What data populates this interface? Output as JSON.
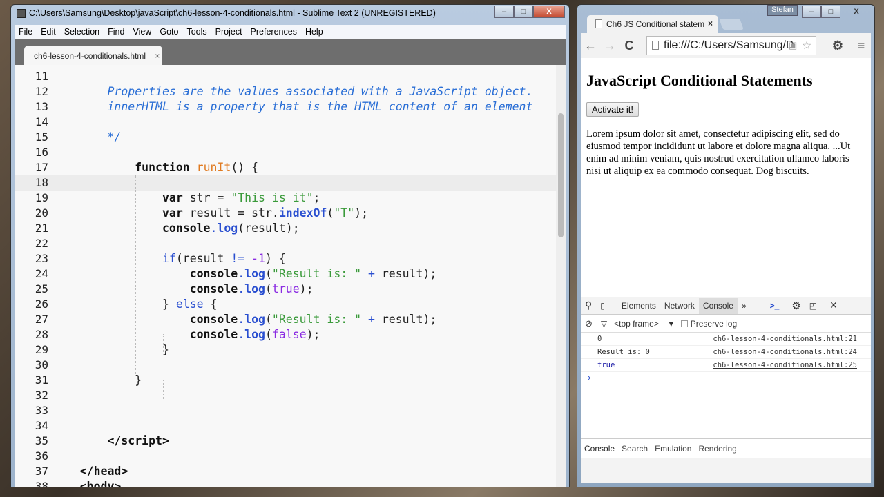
{
  "editor": {
    "title": "C:\\Users\\Samsung\\Desktop\\javaScript\\ch6-lesson-4-conditionals.html - Sublime Text 2 (UNREGISTERED)",
    "menu": [
      "File",
      "Edit",
      "Selection",
      "Find",
      "View",
      "Goto",
      "Tools",
      "Project",
      "Preferences",
      "Help"
    ],
    "tab": "ch6-lesson-4-conditionals.html",
    "tab_close": "×",
    "window_buttons": [
      "–",
      "□",
      "X"
    ],
    "lines": [
      {
        "n": "11",
        "t": []
      },
      {
        "n": "12",
        "t": [
          [
            "        ",
            "p"
          ],
          [
            "Properties are the values associated with a JavaScript object.",
            "c"
          ]
        ]
      },
      {
        "n": "13",
        "t": [
          [
            "        ",
            "p"
          ],
          [
            "innerHTML is a property that is the HTML content of an element",
            "c"
          ]
        ]
      },
      {
        "n": "14",
        "t": []
      },
      {
        "n": "15",
        "t": [
          [
            "        ",
            "p"
          ],
          [
            "*/",
            "c"
          ]
        ]
      },
      {
        "n": "16",
        "t": []
      },
      {
        "n": "17",
        "t": [
          [
            "            ",
            "p"
          ],
          [
            "function",
            "k"
          ],
          [
            " ",
            "p"
          ],
          [
            "runIt",
            "f"
          ],
          [
            "() {",
            "p"
          ]
        ]
      },
      {
        "n": "18",
        "t": [],
        "cur": true
      },
      {
        "n": "19",
        "t": [
          [
            "                ",
            "p"
          ],
          [
            "var",
            "k"
          ],
          [
            " str = ",
            "p"
          ],
          [
            "\"This is it\"",
            "s"
          ],
          [
            ";",
            "p"
          ]
        ]
      },
      {
        "n": "20",
        "t": [
          [
            "                ",
            "p"
          ],
          [
            "var",
            "k"
          ],
          [
            " result = str.",
            "p"
          ],
          [
            "indexOf",
            "m"
          ],
          [
            "(",
            "p"
          ],
          [
            "\"T\"",
            "s"
          ],
          [
            ");",
            "p"
          ]
        ]
      },
      {
        "n": "21",
        "t": [
          [
            "                ",
            "p"
          ],
          [
            "console",
            "k"
          ],
          [
            ".",
            "o"
          ],
          [
            "log",
            "m"
          ],
          [
            "(result);",
            "p"
          ]
        ]
      },
      {
        "n": "22",
        "t": []
      },
      {
        "n": "23",
        "t": [
          [
            "                ",
            "p"
          ],
          [
            "if",
            "o"
          ],
          [
            "(result ",
            "p"
          ],
          [
            "!=",
            "o"
          ],
          [
            " ",
            "p"
          ],
          [
            "-1",
            "n"
          ],
          [
            ") {",
            "p"
          ]
        ]
      },
      {
        "n": "24",
        "t": [
          [
            "                    ",
            "p"
          ],
          [
            "console",
            "k"
          ],
          [
            ".",
            "o"
          ],
          [
            "log",
            "m"
          ],
          [
            "(",
            "p"
          ],
          [
            "\"Result is: \"",
            "s"
          ],
          [
            " ",
            "p"
          ],
          [
            "+",
            "o"
          ],
          [
            " result);",
            "p"
          ]
        ]
      },
      {
        "n": "25",
        "t": [
          [
            "                    ",
            "p"
          ],
          [
            "console",
            "k"
          ],
          [
            ".",
            "o"
          ],
          [
            "log",
            "m"
          ],
          [
            "(",
            "p"
          ],
          [
            "true",
            "n"
          ],
          [
            ");",
            "p"
          ]
        ]
      },
      {
        "n": "26",
        "t": [
          [
            "                ",
            "p"
          ],
          [
            "}",
            "p"
          ],
          [
            " else ",
            "o"
          ],
          [
            "{",
            "p"
          ]
        ]
      },
      {
        "n": "27",
        "t": [
          [
            "                    ",
            "p"
          ],
          [
            "console",
            "k"
          ],
          [
            ".",
            "o"
          ],
          [
            "log",
            "m"
          ],
          [
            "(",
            "p"
          ],
          [
            "\"Result is: \"",
            "s"
          ],
          [
            " ",
            "p"
          ],
          [
            "+",
            "o"
          ],
          [
            " result);",
            "p"
          ]
        ]
      },
      {
        "n": "28",
        "t": [
          [
            "                    ",
            "p"
          ],
          [
            "console",
            "k"
          ],
          [
            ".",
            "o"
          ],
          [
            "log",
            "m"
          ],
          [
            "(",
            "p"
          ],
          [
            "false",
            "n"
          ],
          [
            ");",
            "p"
          ]
        ]
      },
      {
        "n": "29",
        "t": [
          [
            "                ",
            "p"
          ],
          [
            "}",
            "p"
          ]
        ]
      },
      {
        "n": "30",
        "t": []
      },
      {
        "n": "31",
        "t": [
          [
            "            ",
            "p"
          ],
          [
            "}",
            "p"
          ]
        ]
      },
      {
        "n": "32",
        "t": []
      },
      {
        "n": "33",
        "t": []
      },
      {
        "n": "34",
        "t": []
      },
      {
        "n": "35",
        "t": [
          [
            "        ",
            "p"
          ],
          [
            "</script>",
            "k"
          ]
        ]
      },
      {
        "n": "36",
        "t": []
      },
      {
        "n": "37",
        "t": [
          [
            "    ",
            "p"
          ],
          [
            "</head>",
            "k"
          ]
        ]
      },
      {
        "n": "38",
        "t": [
          [
            "    ",
            "p"
          ],
          [
            "<body>",
            "k"
          ]
        ]
      }
    ]
  },
  "browser": {
    "user": "Stefan",
    "window_buttons": [
      "–",
      "□",
      "X"
    ],
    "tab_title": "Ch6 JS Conditional statem",
    "tab_close": "×",
    "address": "file:///C:/Users/Samsung/D",
    "nav": {
      "back": "←",
      "forward": "→",
      "reload": "C"
    },
    "page": {
      "heading": "JavaScript Conditional Statements",
      "button": "Activate it!",
      "paragraph": "Lorem ipsum dolor sit amet, consectetur adipiscing elit, sed do eiusmod tempor incididunt ut labore et dolore magna aliqua. ...Ut enim ad minim veniam, quis nostrud exercitation ullamco laboris nisi ut aliquip ex ea commodo consequat. Dog biscuits."
    },
    "devtools": {
      "tabs": [
        "Elements",
        "Network",
        "Console"
      ],
      "more": "»",
      "frame": "<top frame>",
      "preserve_log": "Preserve log",
      "messages": [
        {
          "text": "0",
          "src": "ch6-lesson-4-conditionals.html:21",
          "color": "#333333"
        },
        {
          "text": "Result is: 0",
          "src": "ch6-lesson-4-conditionals.html:24",
          "color": "#333333"
        },
        {
          "text": "true",
          "src": "ch6-lesson-4-conditionals.html:25",
          "color": "#1a1aa6"
        }
      ],
      "prompt": "›",
      "drawer_tabs": [
        "Console",
        "Search",
        "Emulation",
        "Rendering"
      ]
    }
  }
}
